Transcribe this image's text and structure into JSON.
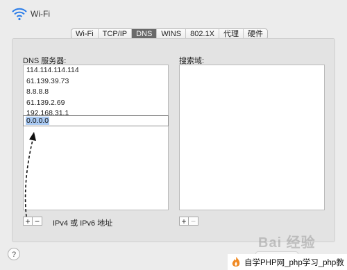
{
  "window": {
    "title": "Wi-Fi"
  },
  "tabs": [
    {
      "label": "Wi-Fi",
      "active": false
    },
    {
      "label": "TCP/IP",
      "active": false
    },
    {
      "label": "DNS",
      "active": true
    },
    {
      "label": "WINS",
      "active": false
    },
    {
      "label": "802.1X",
      "active": false
    },
    {
      "label": "代理",
      "active": false
    },
    {
      "label": "硬件",
      "active": false
    }
  ],
  "dns": {
    "label": "DNS 服务器:",
    "servers": [
      "114.114.114.114",
      "61.139.39.73",
      "8.8.8.8",
      "61.139.2.69",
      "192.168.31.1"
    ],
    "editing_value": "0.0.0.0",
    "add_label": "+",
    "remove_label": "−",
    "hint": "IPv4 或 IPv6 地址"
  },
  "search": {
    "label": "搜索域:",
    "add_label": "+",
    "remove_label": "−"
  },
  "help": {
    "label": "?"
  },
  "watermark": {
    "baidu": "Bai 经验",
    "footer": "自学PHP网_php学习_php教"
  },
  "colors": {
    "accent_tab": "#6a6a6a",
    "selection": "#a9c9f2",
    "watermark_logo": "#f08a24"
  }
}
